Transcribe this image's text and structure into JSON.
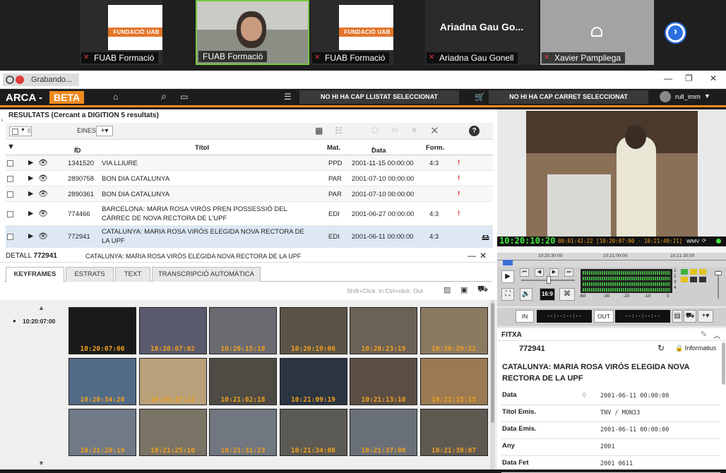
{
  "meeting": {
    "tiles": [
      {
        "name": "FUAB Formació",
        "logo": "FUNDACIÓ UAB",
        "muted": true
      },
      {
        "name": "FUAB Formació",
        "muted": false
      },
      {
        "name": "FUAB Formació",
        "logo": "FUNDACIÓ UAB",
        "muted": true
      },
      {
        "name": "Ariadna Gau Gonell",
        "big": "Ariadna Gau Go...",
        "muted": true
      },
      {
        "name": "Xavier Pampliega",
        "muted": true
      }
    ]
  },
  "window": {
    "recording": "Grabando..."
  },
  "header": {
    "brand": "ARCA -",
    "beta": "BETA",
    "list_btn": "NO HI HA CAP LLISTAT SELECCIONAT",
    "cart_btn": "NO HI HA CAP CARRET SELECCIONAT",
    "user": "rull_imm"
  },
  "results": {
    "title": "RESULTATS (Cercant a DIGITION 5 resultats)",
    "count": "0",
    "tools_label": "EINES",
    "columns": {
      "id": "ID",
      "title": "Títol",
      "mat": "Mat.",
      "date": "Data",
      "form": "Form."
    },
    "rows": [
      {
        "id": "1341520",
        "title": "VIA LLIURE",
        "mat": "PPD",
        "date": "2001-11-15 00:00:00",
        "form": "4:3",
        "alert": "!"
      },
      {
        "id": "2890758",
        "title": "BON DIA CATALUNYA",
        "mat": "PAR",
        "date": "2001-07-10 00:00:00",
        "form": "",
        "alert": "!"
      },
      {
        "id": "2890361",
        "title": "BON DIA CATALUNYA",
        "mat": "PAR",
        "date": "2001-07-10 00:00:00",
        "form": "",
        "alert": "!"
      },
      {
        "id": "774466",
        "title": "BARCELONA: MARIA ROSA VIRÓS PREN POSSESSIÓ DEL CÀRREC DE NOVA RECTORA DE L'UPF",
        "mat": "EDI",
        "date": "2001-06-27 00:00:00",
        "form": "4:3",
        "alert": "!"
      },
      {
        "id": "772941",
        "title": "CATALUNYA: MARIA ROSA VIRÓS ELEGIDA NOVA RECTORA DE LA UPF",
        "mat": "EDI",
        "date": "2001-06-11 00:00:00",
        "form": "4:3",
        "alert": ""
      }
    ]
  },
  "detail": {
    "label": "DETALL",
    "id": "772941",
    "title": "CATALUNYA: MARIA ROSA VIRÓS ELEGIDA NOVA RECTORA DE LA UPF",
    "tabs": [
      "KEYFRAMES",
      "ESTRATS",
      "TEXT",
      "TRANSCRIPCIÓ AUTOMÀTICA"
    ],
    "hint": "Shift+Click: In Ctrl+click: Out",
    "current_tc": "10:20:07:00",
    "keyframes": [
      "10:20:07:00",
      "10:20:07:02",
      "10:20:15:18",
      "10:20:19:06",
      "10:20:23:19",
      "10:20:29:22",
      "10:20:34:20",
      "10:20:37:22",
      "10:21:02:18",
      "10:21:09:19",
      "10:21:13:10",
      "10:21:15:15",
      "10:21:20:19",
      "10:21:25:10",
      "10:21:31:23",
      "10:21:34:06",
      "10:21:37:00",
      "10:21:39:07"
    ]
  },
  "player": {
    "timecode": "10:20:10:20",
    "range": "00:01:42:22 [10:20:07:00 - 10:21:49:21]",
    "format": "WMV",
    "ruler": [
      "10:20:30:00",
      "10:21:00:00",
      "10:21:30:00"
    ],
    "aspect": "16:9",
    "meter": [
      "-60",
      "-30",
      "-20",
      "-10",
      "0"
    ],
    "channels": [
      "1",
      "2",
      "3",
      "4"
    ],
    "in_label": "IN",
    "out_label": "OUT",
    "in_tc": "--:--:--:--",
    "out_tc": "--:--:--:--"
  },
  "fitxa": {
    "label": "FITXA",
    "id": "772941",
    "status": "Informatius",
    "title": "CATALUNYA: MARIA ROSA VIRÓS ELEGIDA NOVA RECTORA DE LA UPF",
    "fields": [
      {
        "k": "Data",
        "v": "2001-06-11 00:00:00"
      },
      {
        "k": "Títol Emis.",
        "v": "TNV / MON33"
      },
      {
        "k": "Data Emis.",
        "v": "2001-06-11 00:00:00"
      },
      {
        "k": "Any",
        "v": "2001"
      },
      {
        "k": "Data Fet",
        "v": "2001 0611"
      }
    ]
  }
}
